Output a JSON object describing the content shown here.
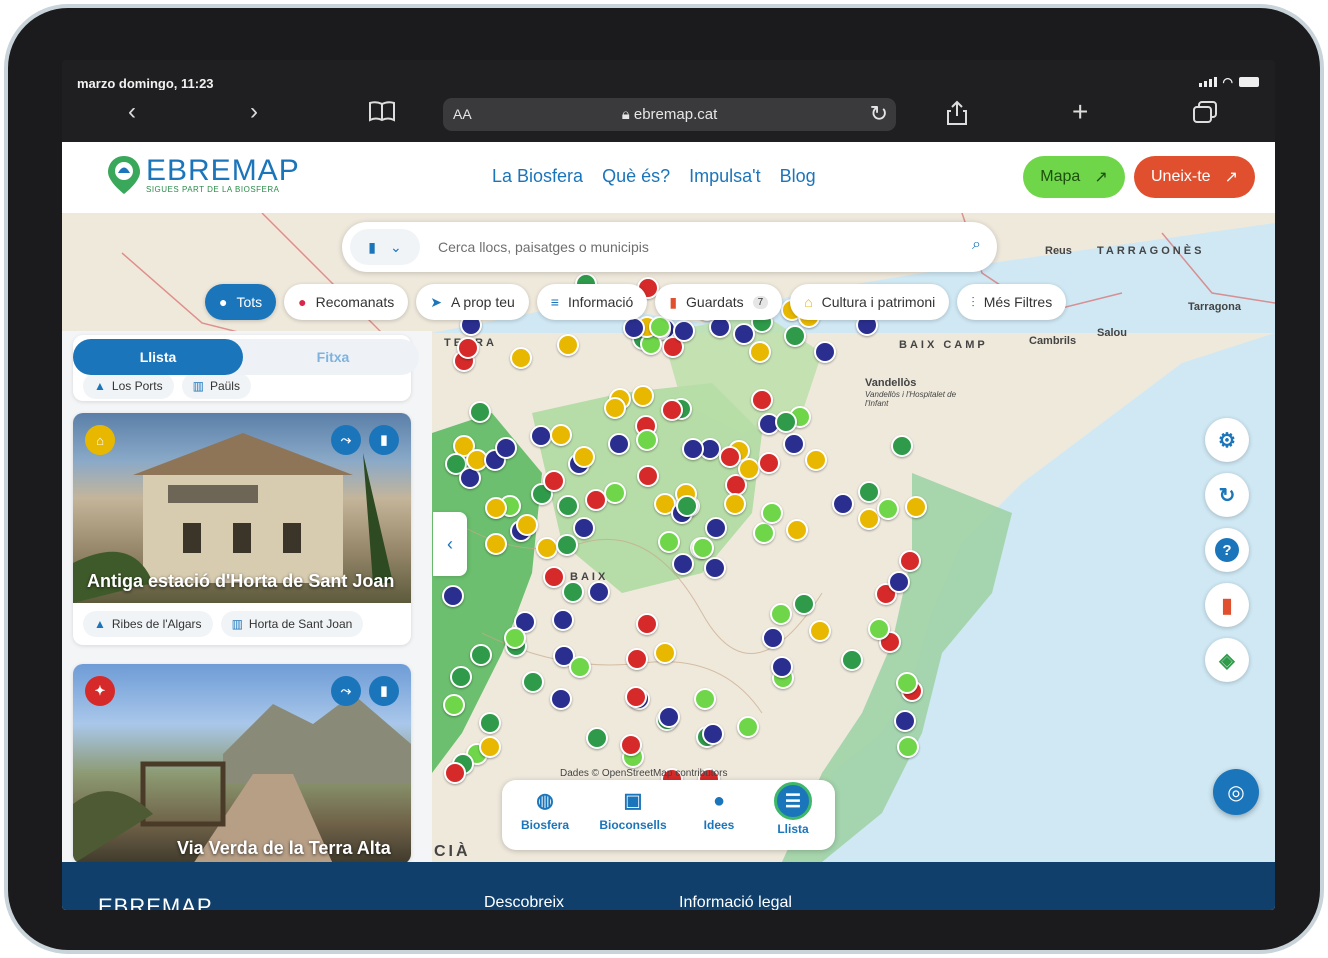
{
  "status": {
    "time": "marzo domingo, 11:23"
  },
  "browser": {
    "aa": "AA",
    "url": "ebremap.cat"
  },
  "header": {
    "logo": "EBREMAP",
    "logo_sub": "SIGUES PART DE LA BIOSFERA",
    "nav": [
      "La Biosfera",
      "Què és?",
      "Impulsa't",
      "Blog"
    ],
    "mapa_button": "Mapa",
    "uneix_button": "Uneix-te"
  },
  "search": {
    "placeholder": "Cerca llocs, paisatges o municipis"
  },
  "chips": [
    {
      "label": "Tots",
      "active": true
    },
    {
      "label": "Recomanats"
    },
    {
      "label": "A prop teu"
    },
    {
      "label": "Informació"
    },
    {
      "label": "Guardats",
      "count": "7"
    },
    {
      "label": "Cultura i patrimoni"
    },
    {
      "label": "Més Filtres"
    }
  ],
  "panel": {
    "tab_list": "Llista",
    "tab_fixed": "Fitxa",
    "prev_tags": [
      "Los Ports",
      "Paüls"
    ],
    "cards": [
      {
        "title": "Antiga estació d'Horta de Sant Joan",
        "tags": [
          "Ribes de l'Algars",
          "Horta de Sant Joan"
        ],
        "category_color": "#e8b800"
      },
      {
        "title": "Via Verda de la Terra Alta",
        "tags": [],
        "category_color": "#d62a2a"
      }
    ]
  },
  "map": {
    "labels": [
      "TERRA",
      "BAIX CAMP",
      "TARRAGONÈS",
      "Reus",
      "Tarragona",
      "Cambrils",
      "Salou",
      "Vandellòs",
      "Vandellòs i l'Hospitalet de l'Infant",
      "BAIX",
      "CIÀ"
    ],
    "attribution": "Dades © OpenStreetMap contributors"
  },
  "bottom_nav": [
    {
      "label": "Biosfera"
    },
    {
      "label": "Bioconsells"
    },
    {
      "label": "Idees"
    },
    {
      "label": "Llista",
      "active": true
    }
  ],
  "footer": {
    "logo": "EBREMAP",
    "col1": "Descobreix",
    "col2": "Informació legal"
  },
  "colors": {
    "brand_blue": "#1b75bb",
    "green": "#6fd64a",
    "orange": "#e1502e",
    "footer": "#0f3f6a"
  }
}
